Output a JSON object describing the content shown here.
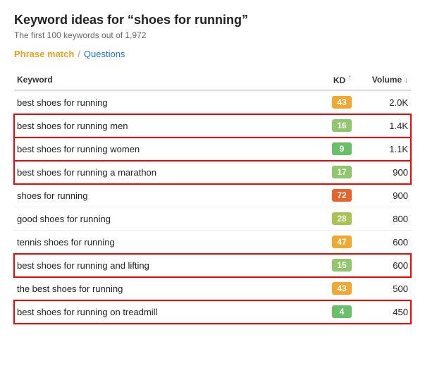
{
  "title": "Keyword ideas for “shoes for running”",
  "subtitle": "The first 100 keywords out of 1,972",
  "tabs": {
    "phrase": "Phrase match",
    "sep": "/",
    "questions": "Questions"
  },
  "table": {
    "columns": {
      "keyword": "Keyword",
      "kd": "KD",
      "volume": "Volume"
    },
    "rows": [
      {
        "keyword": "best shoes for running",
        "kd": 43,
        "kd_color": "orange",
        "volume": "2.0K",
        "highlighted": false
      },
      {
        "keyword": "best shoes for running men",
        "kd": 16,
        "kd_color": "light-green",
        "volume": "1.4K",
        "highlighted": true
      },
      {
        "keyword": "best shoes for running women",
        "kd": 9,
        "kd_color": "green",
        "volume": "1.1K",
        "highlighted": true
      },
      {
        "keyword": "best shoes for running a marathon",
        "kd": 17,
        "kd_color": "light-green",
        "volume": "900",
        "highlighted": true
      },
      {
        "keyword": "shoes for running",
        "kd": 72,
        "kd_color": "red-orange",
        "volume": "900",
        "highlighted": false
      },
      {
        "keyword": "good shoes for running",
        "kd": 28,
        "kd_color": "yellow-green",
        "volume": "800",
        "highlighted": false
      },
      {
        "keyword": "tennis shoes for running",
        "kd": 47,
        "kd_color": "orange",
        "volume": "600",
        "highlighted": false
      },
      {
        "keyword": "best shoes for running and lifting",
        "kd": 15,
        "kd_color": "light-green",
        "volume": "600",
        "highlighted": true
      },
      {
        "keyword": "the best shoes for running",
        "kd": 43,
        "kd_color": "orange",
        "volume": "500",
        "highlighted": false
      },
      {
        "keyword": "best shoes for running on treadmill",
        "kd": 4,
        "kd_color": "green",
        "volume": "450",
        "highlighted": true
      }
    ]
  }
}
